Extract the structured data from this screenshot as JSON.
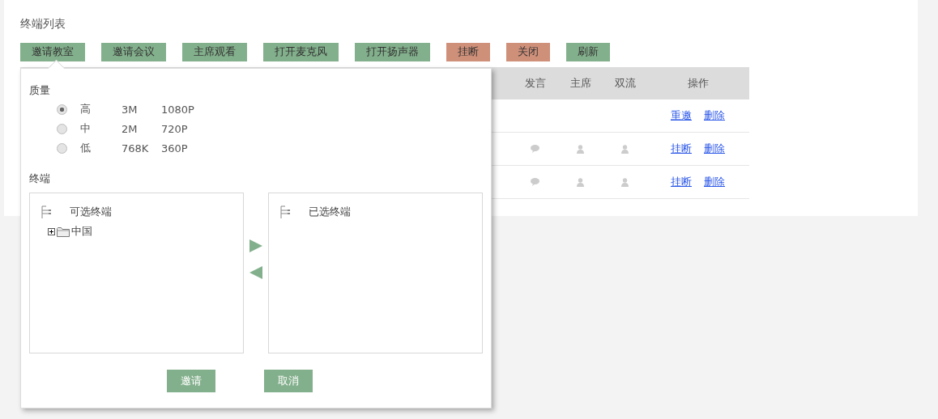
{
  "title": "终端列表",
  "toolbar": [
    {
      "label": "邀请教室",
      "kind": "normal"
    },
    {
      "label": "邀请会议",
      "kind": "normal"
    },
    {
      "label": "主席观看",
      "kind": "normal"
    },
    {
      "label": "打开麦克风",
      "kind": "normal"
    },
    {
      "label": "打开扬声器",
      "kind": "normal"
    },
    {
      "label": "挂断",
      "kind": "danger"
    },
    {
      "label": "关闭",
      "kind": "danger"
    },
    {
      "label": "刷新",
      "kind": "normal"
    }
  ],
  "table": {
    "columns": [
      "发言",
      "主席",
      "双流",
      "操作"
    ],
    "rows": [
      {
        "status_icons": false,
        "actions": [
          "重邀",
          "删除"
        ]
      },
      {
        "status_icons": true,
        "actions": [
          "挂断",
          "删除"
        ]
      },
      {
        "status_icons": true,
        "actions": [
          "挂断",
          "删除"
        ]
      }
    ]
  },
  "popup": {
    "quality_label": "质量",
    "qualities": [
      {
        "level_name": "高",
        "bitrate": "3M",
        "resolution": "1080P",
        "selected": true
      },
      {
        "level_name": "中",
        "bitrate": "2M",
        "resolution": "720P",
        "selected": false
      },
      {
        "level_name": "低",
        "bitrate": "768K",
        "resolution": "360P",
        "selected": false
      }
    ],
    "terminal_label": "终端",
    "available": {
      "title": "可选终端",
      "children": [
        {
          "label": "中国",
          "expanded": false
        }
      ]
    },
    "selected_list": {
      "title": "已选终端"
    },
    "buttons": [
      "邀请",
      "取消"
    ]
  }
}
